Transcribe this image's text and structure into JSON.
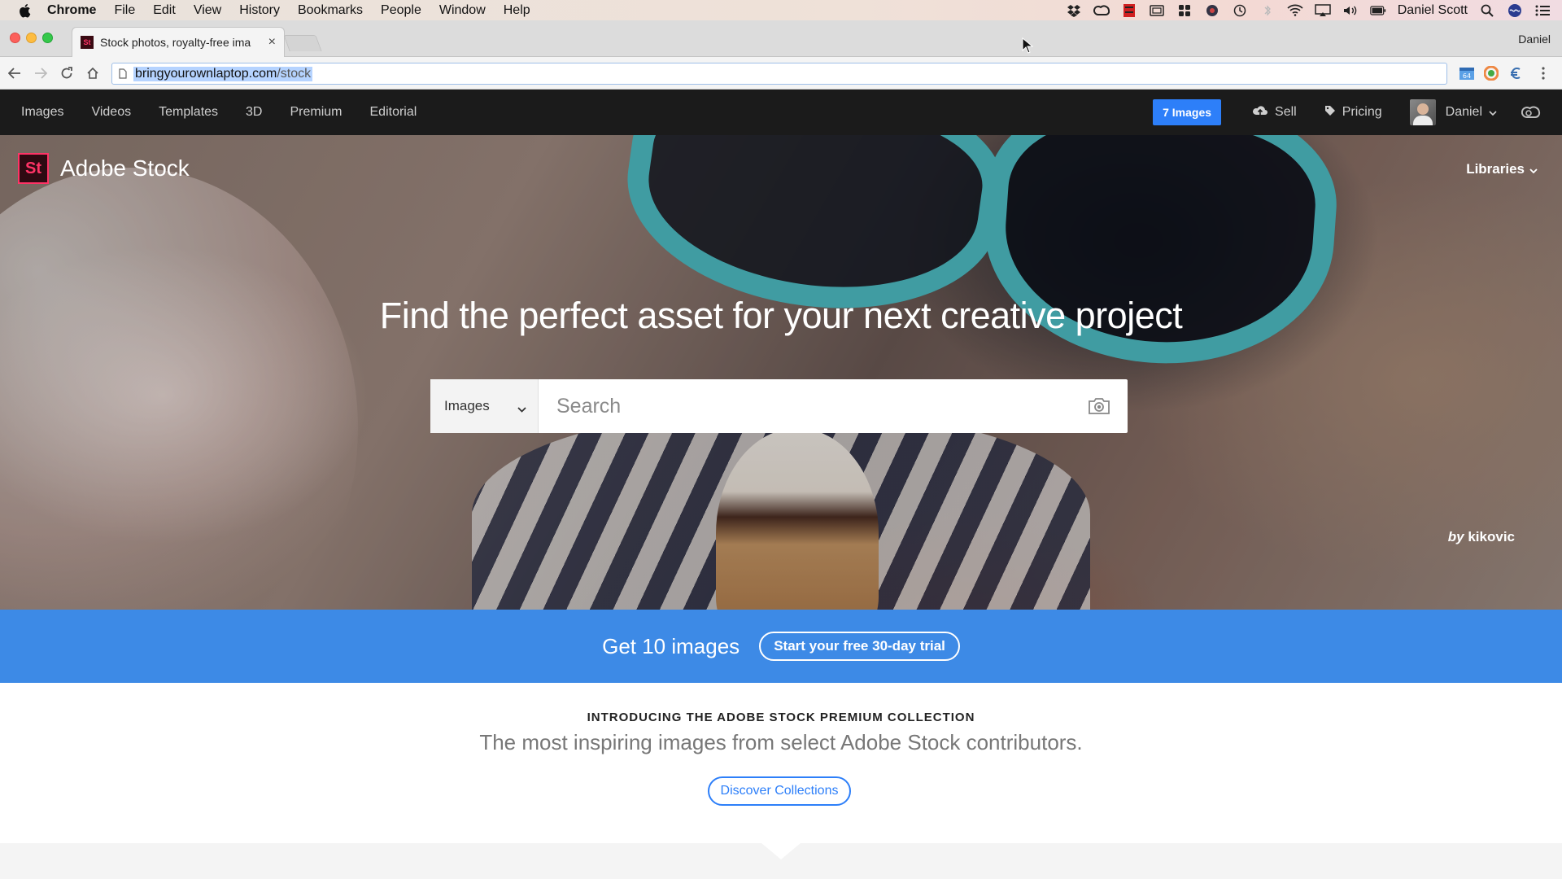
{
  "menubar": {
    "app": "Chrome",
    "items": [
      "File",
      "Edit",
      "View",
      "History",
      "Bookmarks",
      "People",
      "Window",
      "Help"
    ],
    "user": "Daniel Scott",
    "tray_icons": [
      "dropbox-icon",
      "creative-cloud-icon",
      "red-app-icon",
      "airplay-display-icon",
      "grid-app-icon",
      "cloud-app-icon",
      "time-machine-icon",
      "bluetooth-icon",
      "wifi-icon",
      "screen-mirroring-icon",
      "volume-icon",
      "battery-icon",
      "spotlight-icon",
      "siri-icon",
      "notification-center-icon"
    ]
  },
  "browser": {
    "tab_title": "Stock photos, royalty-free ima",
    "tab_favicon": "St",
    "profile_name": "Daniel",
    "url_domain": "bringyourownlaptop.com",
    "url_path": "/stock"
  },
  "stock_nav": {
    "links": [
      "Images",
      "Videos",
      "Templates",
      "3D",
      "Premium",
      "Editorial"
    ],
    "cart_label": "7 Images",
    "sell_label": "Sell",
    "pricing_label": "Pricing",
    "user_label": "Daniel"
  },
  "hero": {
    "brand_logo": "St",
    "brand_name": "Adobe Stock",
    "libraries_label": "Libraries",
    "headline": "Find the perfect asset for your next creative project",
    "search_type": "Images",
    "search_placeholder": "Search",
    "credit_by": "by",
    "credit_author": "kikovic"
  },
  "promo": {
    "text": "Get 10 images",
    "button": "Start your free 30-day trial"
  },
  "premium": {
    "eyebrow": "INTRODUCING THE ADOBE STOCK PREMIUM COLLECTION",
    "subtitle": "The most inspiring images from select Adobe Stock contributors.",
    "button": "Discover Collections"
  },
  "colors": {
    "accent_blue": "#2d7ff9",
    "promo_blue": "#3d8ae6",
    "nav_dark": "#1b1b1b",
    "brand_pink": "#ff3366"
  }
}
